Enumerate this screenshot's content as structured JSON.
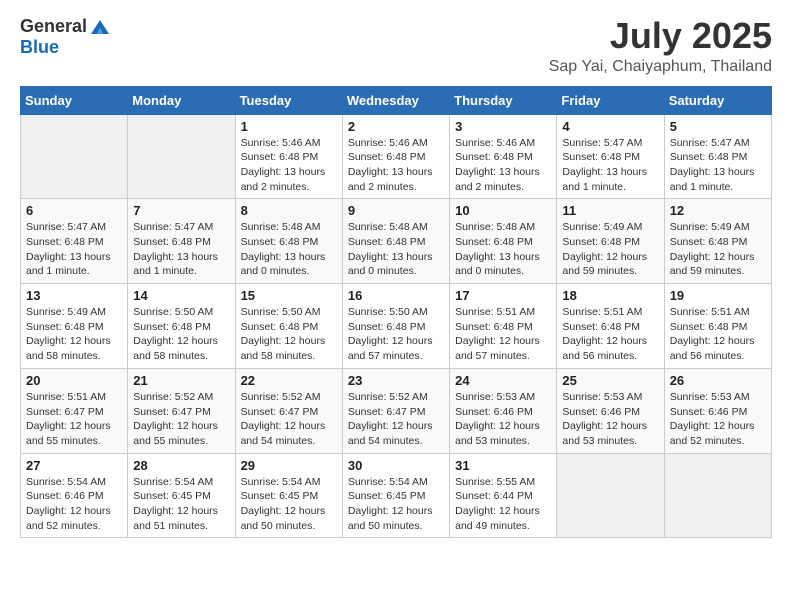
{
  "header": {
    "logo_general": "General",
    "logo_blue": "Blue",
    "main_title": "July 2025",
    "sub_title": "Sap Yai, Chaiyaphum, Thailand"
  },
  "calendar": {
    "days_of_week": [
      "Sunday",
      "Monday",
      "Tuesday",
      "Wednesday",
      "Thursday",
      "Friday",
      "Saturday"
    ],
    "weeks": [
      [
        {
          "day": "",
          "info": ""
        },
        {
          "day": "",
          "info": ""
        },
        {
          "day": "1",
          "info": "Sunrise: 5:46 AM\nSunset: 6:48 PM\nDaylight: 13 hours and 2 minutes."
        },
        {
          "day": "2",
          "info": "Sunrise: 5:46 AM\nSunset: 6:48 PM\nDaylight: 13 hours and 2 minutes."
        },
        {
          "day": "3",
          "info": "Sunrise: 5:46 AM\nSunset: 6:48 PM\nDaylight: 13 hours and 2 minutes."
        },
        {
          "day": "4",
          "info": "Sunrise: 5:47 AM\nSunset: 6:48 PM\nDaylight: 13 hours and 1 minute."
        },
        {
          "day": "5",
          "info": "Sunrise: 5:47 AM\nSunset: 6:48 PM\nDaylight: 13 hours and 1 minute."
        }
      ],
      [
        {
          "day": "6",
          "info": "Sunrise: 5:47 AM\nSunset: 6:48 PM\nDaylight: 13 hours and 1 minute."
        },
        {
          "day": "7",
          "info": "Sunrise: 5:47 AM\nSunset: 6:48 PM\nDaylight: 13 hours and 1 minute."
        },
        {
          "day": "8",
          "info": "Sunrise: 5:48 AM\nSunset: 6:48 PM\nDaylight: 13 hours and 0 minutes."
        },
        {
          "day": "9",
          "info": "Sunrise: 5:48 AM\nSunset: 6:48 PM\nDaylight: 13 hours and 0 minutes."
        },
        {
          "day": "10",
          "info": "Sunrise: 5:48 AM\nSunset: 6:48 PM\nDaylight: 13 hours and 0 minutes."
        },
        {
          "day": "11",
          "info": "Sunrise: 5:49 AM\nSunset: 6:48 PM\nDaylight: 12 hours and 59 minutes."
        },
        {
          "day": "12",
          "info": "Sunrise: 5:49 AM\nSunset: 6:48 PM\nDaylight: 12 hours and 59 minutes."
        }
      ],
      [
        {
          "day": "13",
          "info": "Sunrise: 5:49 AM\nSunset: 6:48 PM\nDaylight: 12 hours and 58 minutes."
        },
        {
          "day": "14",
          "info": "Sunrise: 5:50 AM\nSunset: 6:48 PM\nDaylight: 12 hours and 58 minutes."
        },
        {
          "day": "15",
          "info": "Sunrise: 5:50 AM\nSunset: 6:48 PM\nDaylight: 12 hours and 58 minutes."
        },
        {
          "day": "16",
          "info": "Sunrise: 5:50 AM\nSunset: 6:48 PM\nDaylight: 12 hours and 57 minutes."
        },
        {
          "day": "17",
          "info": "Sunrise: 5:51 AM\nSunset: 6:48 PM\nDaylight: 12 hours and 57 minutes."
        },
        {
          "day": "18",
          "info": "Sunrise: 5:51 AM\nSunset: 6:48 PM\nDaylight: 12 hours and 56 minutes."
        },
        {
          "day": "19",
          "info": "Sunrise: 5:51 AM\nSunset: 6:48 PM\nDaylight: 12 hours and 56 minutes."
        }
      ],
      [
        {
          "day": "20",
          "info": "Sunrise: 5:51 AM\nSunset: 6:47 PM\nDaylight: 12 hours and 55 minutes."
        },
        {
          "day": "21",
          "info": "Sunrise: 5:52 AM\nSunset: 6:47 PM\nDaylight: 12 hours and 55 minutes."
        },
        {
          "day": "22",
          "info": "Sunrise: 5:52 AM\nSunset: 6:47 PM\nDaylight: 12 hours and 54 minutes."
        },
        {
          "day": "23",
          "info": "Sunrise: 5:52 AM\nSunset: 6:47 PM\nDaylight: 12 hours and 54 minutes."
        },
        {
          "day": "24",
          "info": "Sunrise: 5:53 AM\nSunset: 6:46 PM\nDaylight: 12 hours and 53 minutes."
        },
        {
          "day": "25",
          "info": "Sunrise: 5:53 AM\nSunset: 6:46 PM\nDaylight: 12 hours and 53 minutes."
        },
        {
          "day": "26",
          "info": "Sunrise: 5:53 AM\nSunset: 6:46 PM\nDaylight: 12 hours and 52 minutes."
        }
      ],
      [
        {
          "day": "27",
          "info": "Sunrise: 5:54 AM\nSunset: 6:46 PM\nDaylight: 12 hours and 52 minutes."
        },
        {
          "day": "28",
          "info": "Sunrise: 5:54 AM\nSunset: 6:45 PM\nDaylight: 12 hours and 51 minutes."
        },
        {
          "day": "29",
          "info": "Sunrise: 5:54 AM\nSunset: 6:45 PM\nDaylight: 12 hours and 50 minutes."
        },
        {
          "day": "30",
          "info": "Sunrise: 5:54 AM\nSunset: 6:45 PM\nDaylight: 12 hours and 50 minutes."
        },
        {
          "day": "31",
          "info": "Sunrise: 5:55 AM\nSunset: 6:44 PM\nDaylight: 12 hours and 49 minutes."
        },
        {
          "day": "",
          "info": ""
        },
        {
          "day": "",
          "info": ""
        }
      ]
    ]
  }
}
